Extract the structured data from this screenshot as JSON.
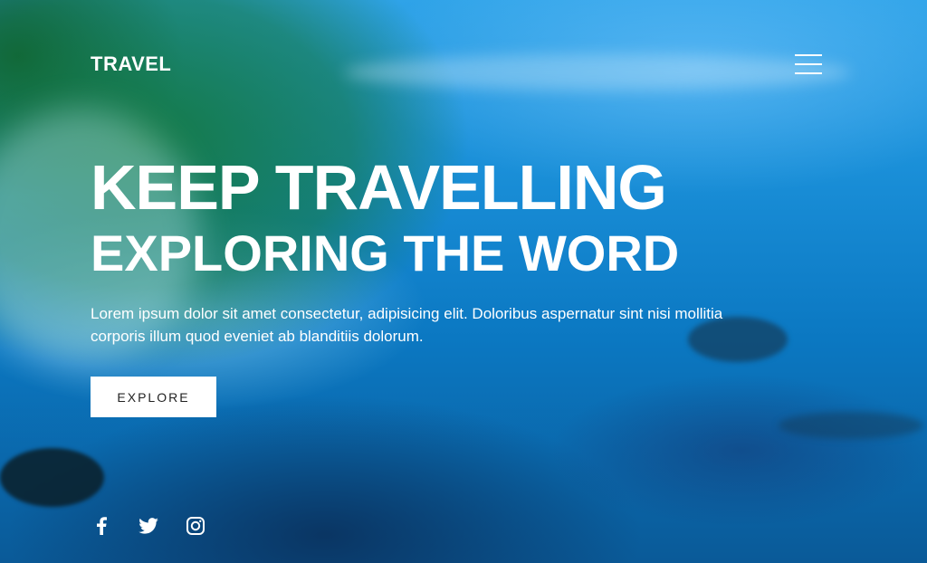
{
  "header": {
    "logo": "TRAVEL"
  },
  "hero": {
    "title_line_1": "KEEP TRAVELLING",
    "title_line_2": "EXPLORING THE WORD",
    "description": "Lorem ipsum dolor sit amet consectetur, adipisicing elit. Doloribus aspernatur sint nisi mollitia corporis illum quod eveniet ab blanditiis dolorum.",
    "explore_label": "EXPLORE"
  },
  "social": {
    "icons": [
      "facebook-icon",
      "twitter-icon",
      "instagram-icon"
    ]
  },
  "colors": {
    "text": "#ffffff",
    "button_bg": "#ffffff",
    "button_text": "#222222"
  }
}
